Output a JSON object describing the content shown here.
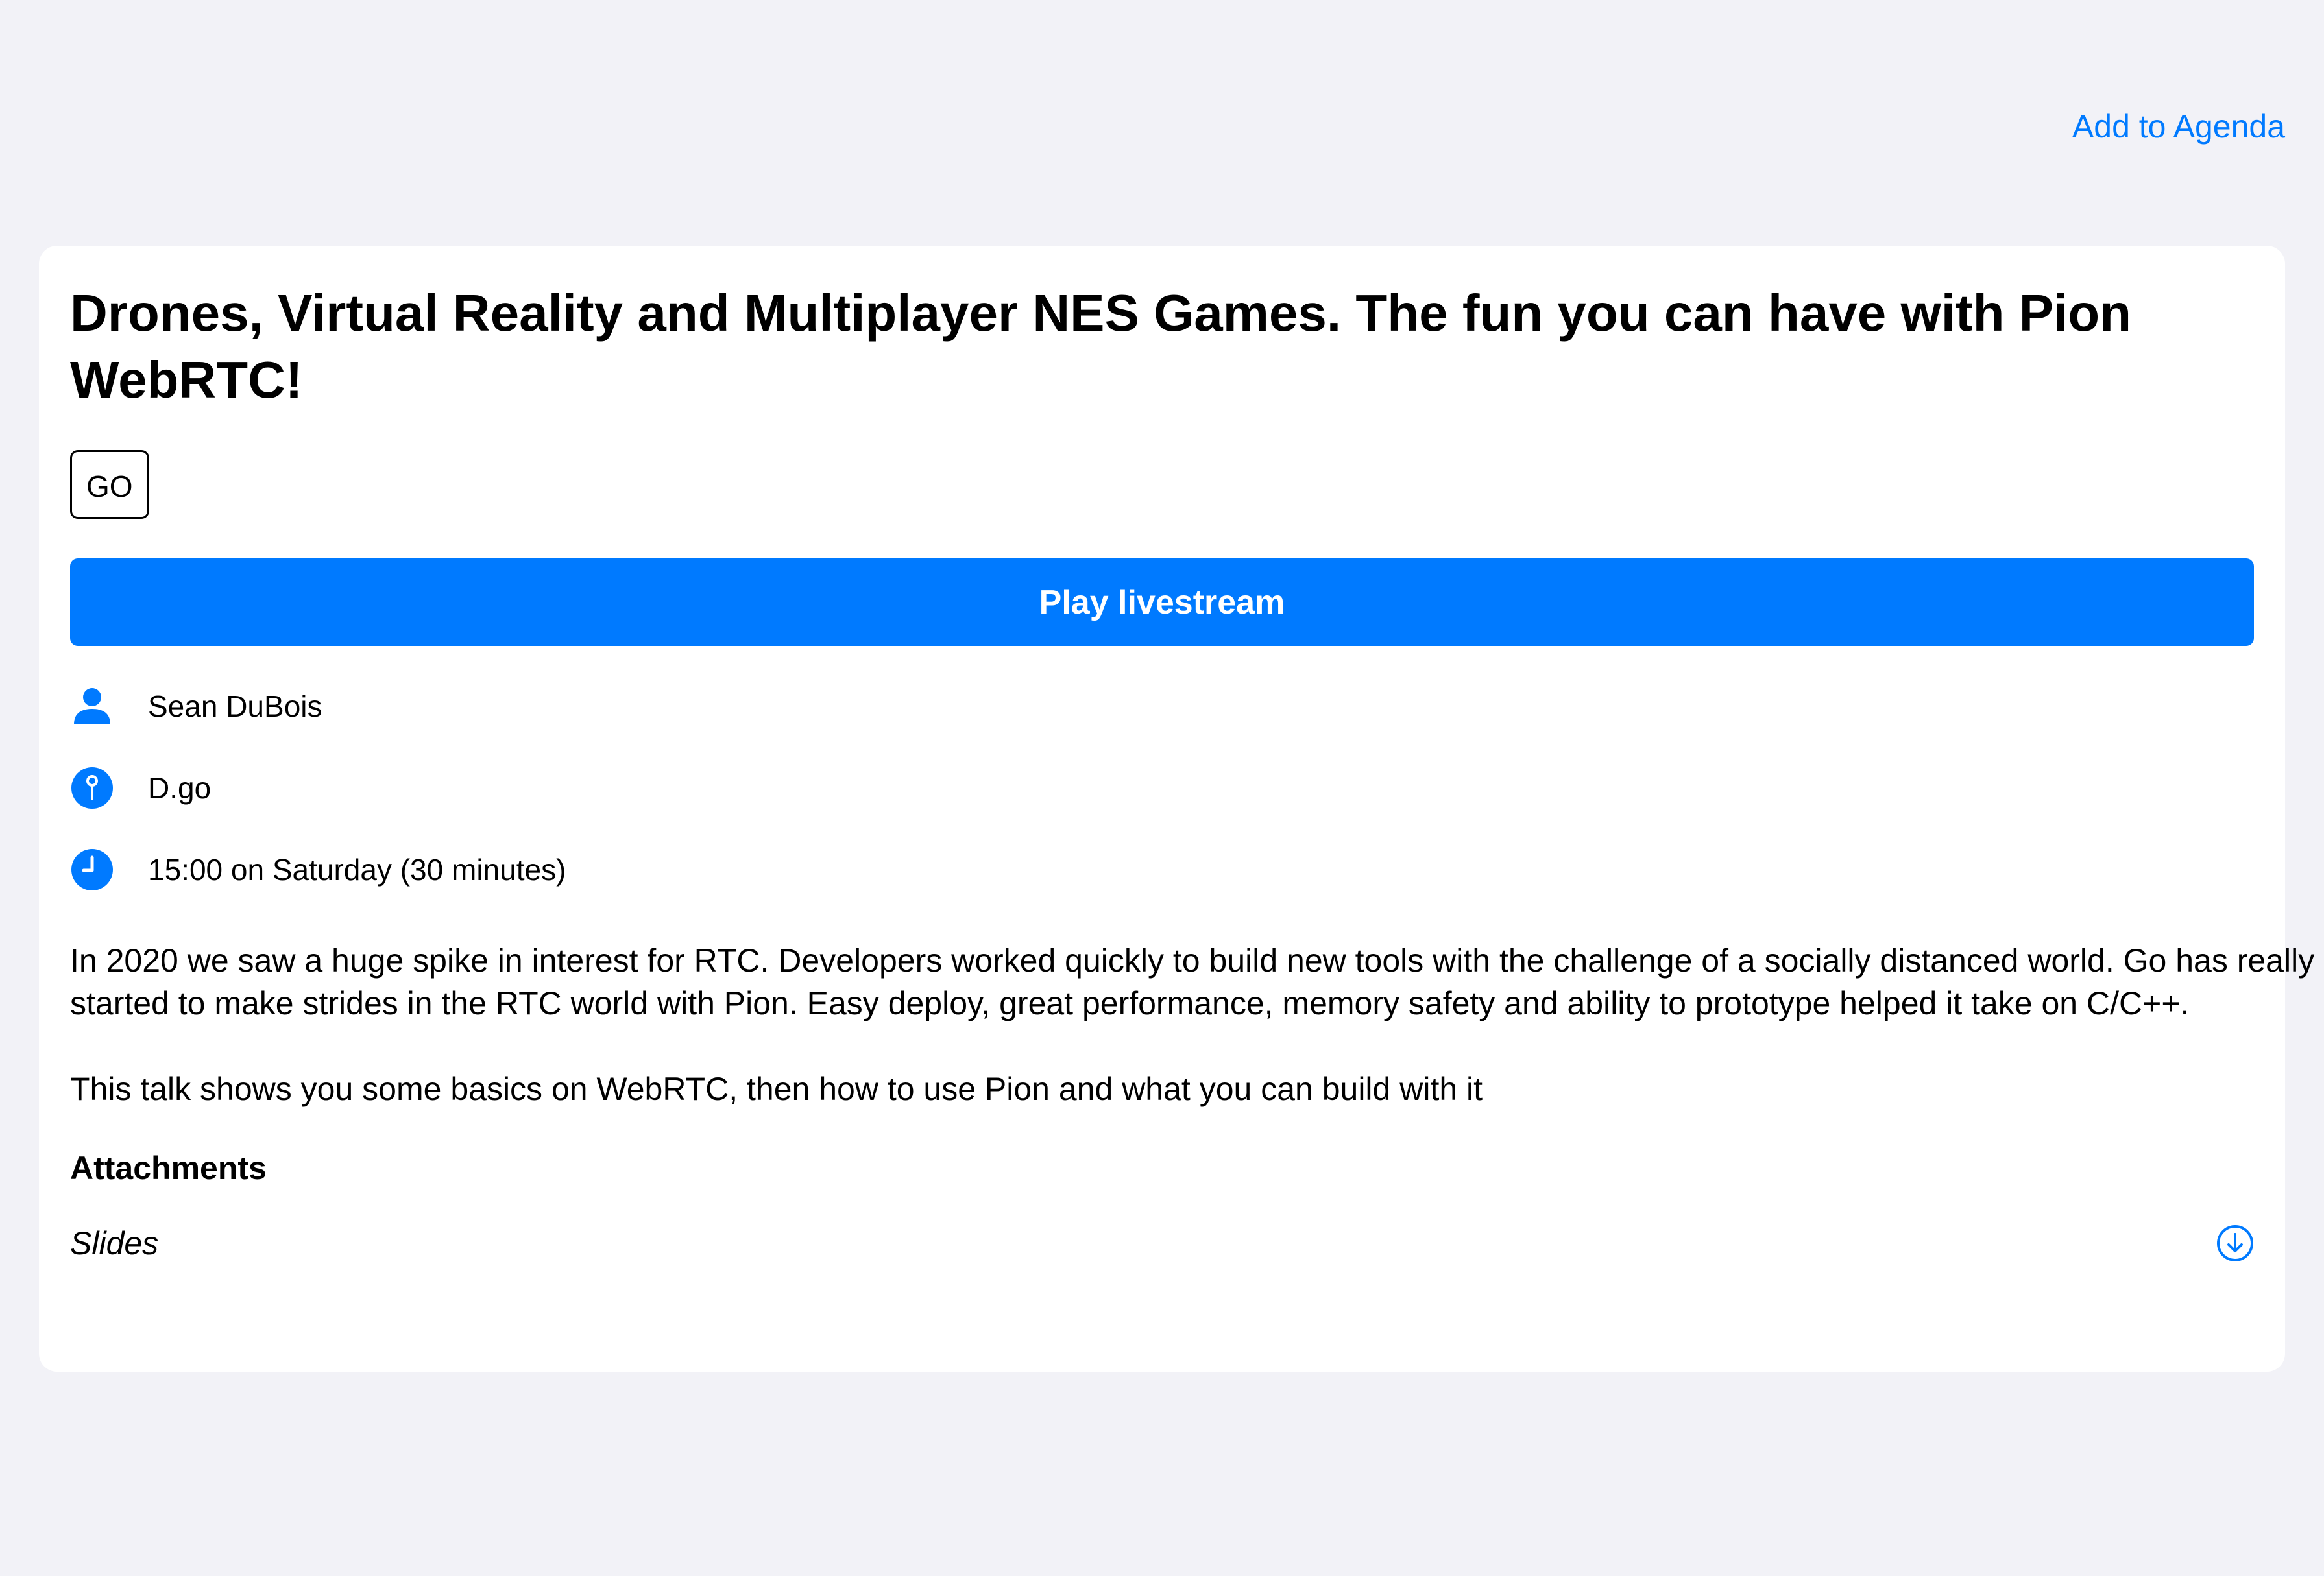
{
  "header": {
    "add_to_agenda": "Add to Agenda"
  },
  "talk": {
    "title": "Drones, Virtual Reality and Multiplayer NES Games. The fun you can have with Pion WebRTC!",
    "tag": "GO",
    "play_label": "Play livestream",
    "speaker": "Sean DuBois",
    "room": "D.go",
    "time": "15:00 on Saturday (30 minutes)",
    "description_1": "In 2020 we saw a huge spike in interest for RTC. Developers worked quickly to build new tools with the challenge of a socially distanced world. Go has really started to make strides in the RTC world with Pion. Easy deploy, great performance, memory safety and ability to prototype helped it take on C/C++.",
    "description_2": "This talk shows you some basics on WebRTC, then how to use Pion and what you can build with it",
    "attachments_heading": "Attachments",
    "attachments": [
      {
        "name": "Slides",
        "icon": "download-icon"
      }
    ]
  },
  "icons": {
    "speaker": "person-icon",
    "room": "location-pin-icon",
    "time": "clock-icon"
  },
  "colors": {
    "accent": "#007aff",
    "background": "#f2f2f7",
    "card": "#ffffff"
  }
}
